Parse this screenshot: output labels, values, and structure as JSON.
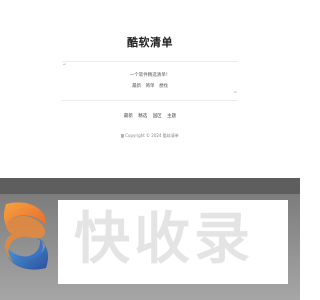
{
  "site": {
    "title": "酷软清单"
  },
  "quote": {
    "open_mark": "“",
    "close_mark": "”",
    "text": "一个软件精选清单！",
    "links": [
      "最新",
      "简单",
      "想找"
    ]
  },
  "nav": {
    "items": [
      "最新",
      "精选",
      "国区",
      "主题"
    ]
  },
  "footer": {
    "copyright": "Copyright © 2024 酷软清单"
  },
  "watermark": {
    "text": "快收录",
    "logo_icon": "s-swirl-logo-icon",
    "colors": {
      "logo_orange": "#f08a3a",
      "logo_blue": "#3d6fbf"
    }
  }
}
